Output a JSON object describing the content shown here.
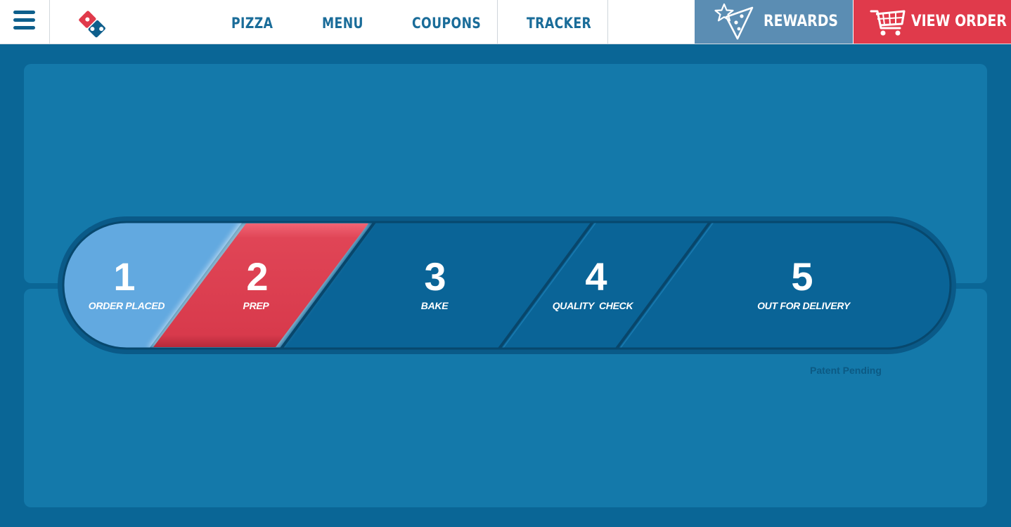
{
  "header": {
    "nav": [
      "PIZZA",
      "MENU",
      "COUPONS",
      "TRACKER"
    ],
    "rewards_label": "REWARDS",
    "order_label": "VIEW ORDER"
  },
  "tracker": {
    "current_step": 2,
    "steps": [
      {
        "number": "1",
        "label": "ORDER PLACED"
      },
      {
        "number": "2",
        "label": "PREP"
      },
      {
        "number": "3",
        "label": "BAKE"
      },
      {
        "number": "4",
        "label": "QUALITY  CHECK"
      },
      {
        "number": "5",
        "label": "OUT FOR DELIVERY"
      }
    ],
    "patent_text": "Patent Pending"
  },
  "colors": {
    "background": "#0a6696",
    "panel": "#1479aa",
    "step_complete": "#62a9e0",
    "step_active": "#e04556",
    "step_pending": "#0a6497",
    "brand_blue": "#0e5f8c",
    "brand_red": "#e03a4b"
  },
  "icons": {
    "menu": "hamburger-icon",
    "logo": "dominos-logo",
    "rewards": "star-pizza-slice-icon",
    "cart": "shopping-cart-icon"
  }
}
